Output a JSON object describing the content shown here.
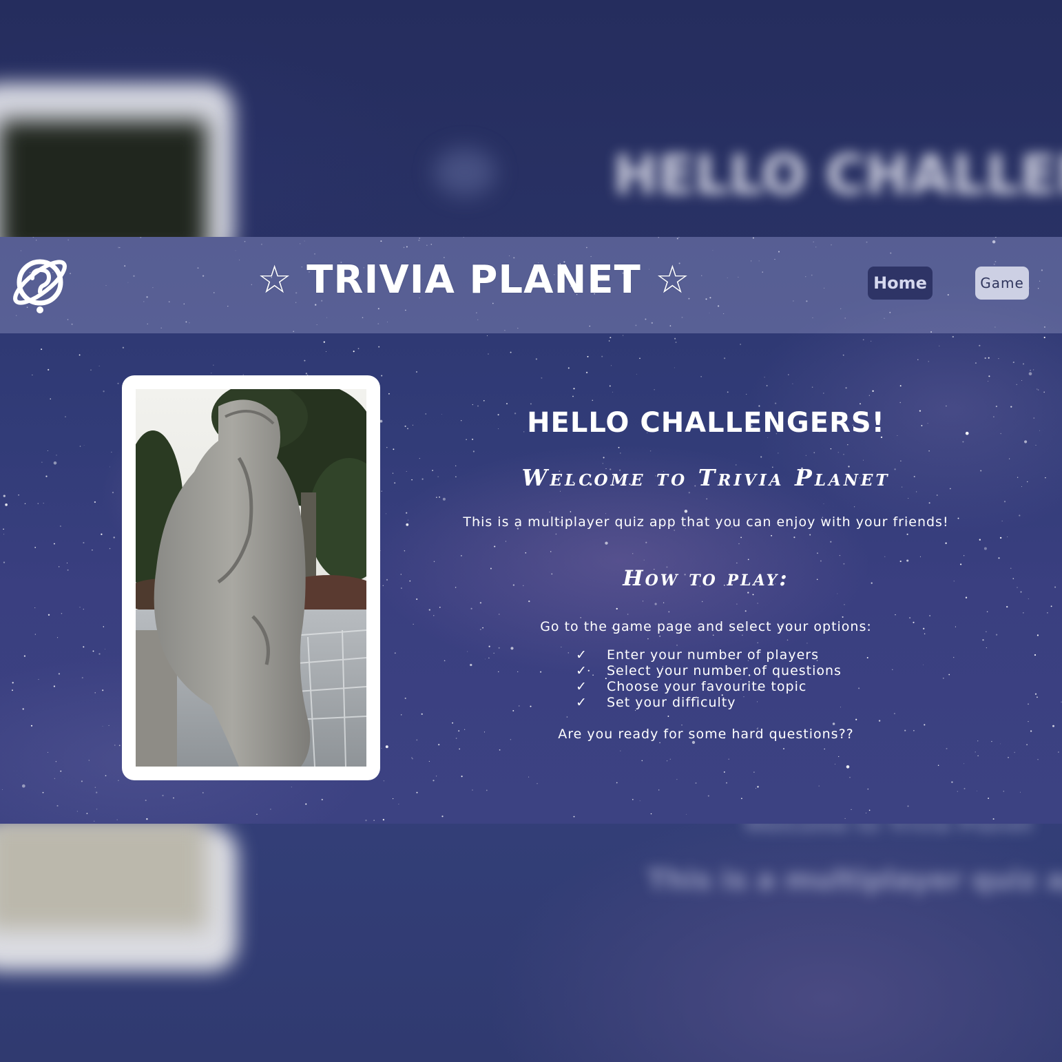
{
  "header": {
    "title": "☆ TRIVIA PLANET ☆",
    "logo_icon": "planet-question-icon",
    "nav": [
      {
        "label": "Home",
        "active": true
      },
      {
        "label": "Game",
        "active": false
      }
    ]
  },
  "main": {
    "greeting": "HELLO CHALLENGERS!",
    "welcome": "Welcome to Trivia Planet",
    "intro": "This is a multiplayer quiz app that you can enjoy with your friends!",
    "howto_title": "How to play:",
    "instructions": "Go to the game page and select your options:",
    "check_icon": "check-mark-icon",
    "check_glyph": "✓",
    "steps": [
      "Enter your number of players",
      "Select your number of questions",
      "Choose your favourite topic",
      "Set your difficulty"
    ],
    "outro": "Are you ready for some hard questions??"
  },
  "colors": {
    "header_bg": "#8c91be",
    "home_button_bg": "#2e3466",
    "game_button_bg": "#cdd0e4",
    "text": "#ffffff",
    "space_bg": "#323c78"
  }
}
